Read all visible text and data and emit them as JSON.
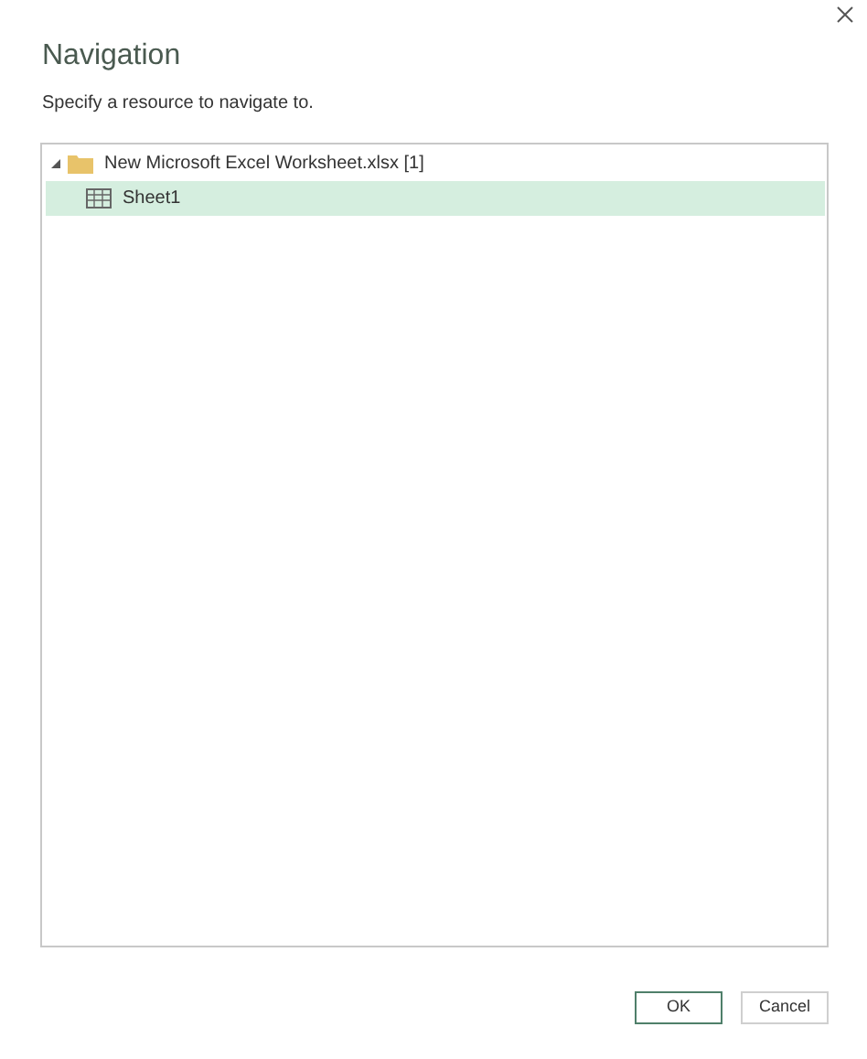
{
  "dialog": {
    "title": "Navigation",
    "subtitle": "Specify a resource to navigate to."
  },
  "tree": [
    {
      "label": "New Microsoft Excel Worksheet.xlsx [1]",
      "kind": "folder",
      "expanded": true,
      "selected": false,
      "children": [
        {
          "label": "Sheet1",
          "kind": "sheet",
          "selected": true
        }
      ]
    }
  ],
  "buttons": [
    {
      "label": "OK",
      "kind": "primary"
    },
    {
      "label": "Cancel",
      "kind": "secondary"
    }
  ]
}
